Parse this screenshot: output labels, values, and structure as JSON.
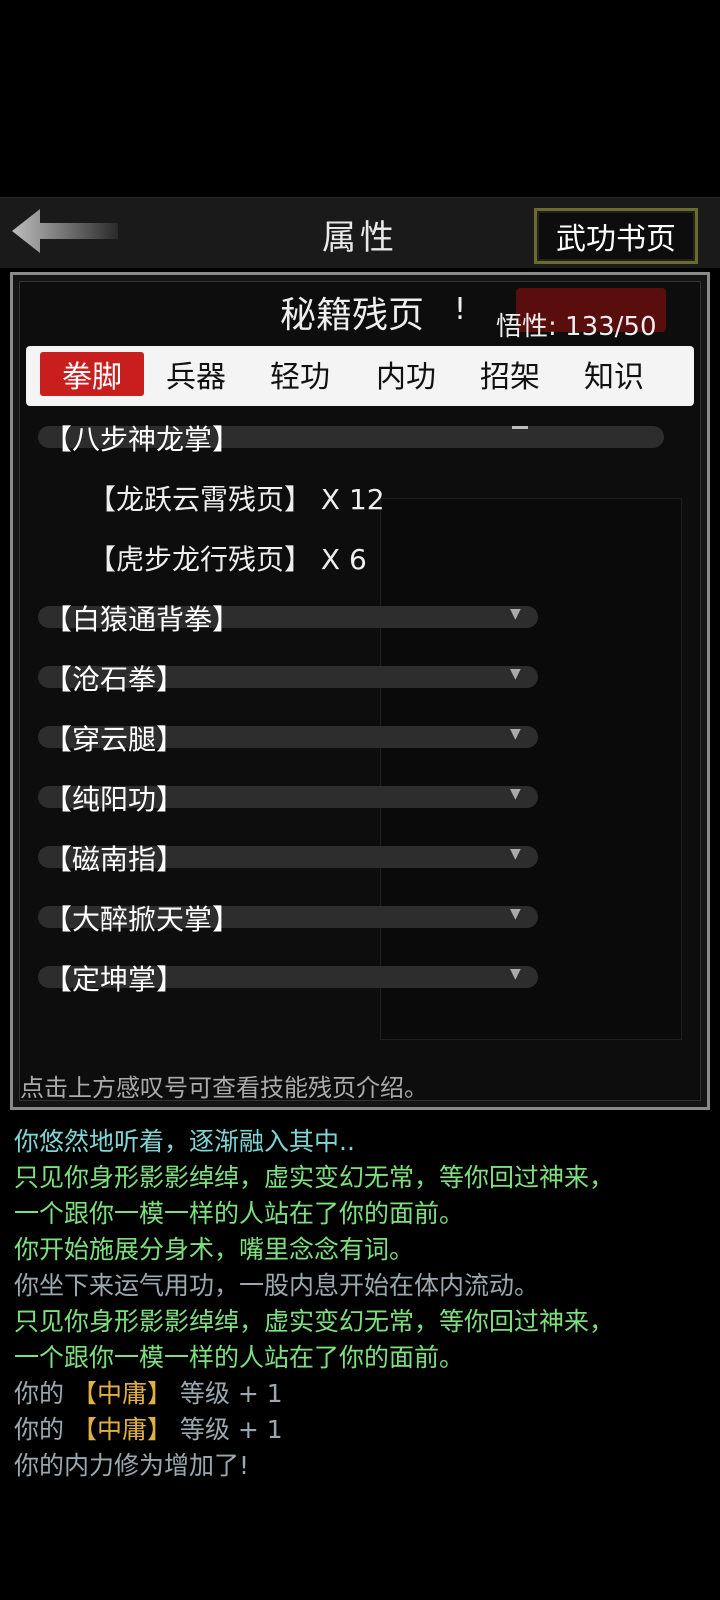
{
  "header": {
    "title": "属性",
    "right_button": "武功书页"
  },
  "panel": {
    "title": "秘籍残页",
    "exclaim": "!",
    "wuxing": "悟性: 133/50",
    "hint": "点击上方感叹号可查看技能残页介绍。"
  },
  "categories": [
    {
      "label": "拳脚",
      "active": true
    },
    {
      "label": "兵器",
      "active": false
    },
    {
      "label": "轻功",
      "active": false
    },
    {
      "label": "内功",
      "active": false
    },
    {
      "label": "招架",
      "active": false
    },
    {
      "label": "知识",
      "active": false
    }
  ],
  "groups": [
    {
      "label": "【八步神龙掌】",
      "open": true,
      "items": [
        {
          "label": "【龙跃云霄残页】 X 12"
        },
        {
          "label": "【虎步龙行残页】 X 6"
        }
      ]
    },
    {
      "label": "【白猿通背拳】",
      "open": false
    },
    {
      "label": "【沧石拳】",
      "open": false
    },
    {
      "label": "【穿云腿】",
      "open": false
    },
    {
      "label": "【纯阳功】",
      "open": false
    },
    {
      "label": "【磁南指】",
      "open": false
    },
    {
      "label": "【大醉掀天掌】",
      "open": false
    },
    {
      "label": "【定坤掌】",
      "open": false
    }
  ],
  "log": [
    {
      "text": "你悠然地听着，逐渐融入其中..",
      "color": "#7fd4d4"
    },
    {
      "text": "只见你身形影影绰绰，虚实变幻无常，等你回过神来，",
      "color": "#7de07d"
    },
    {
      "text": "一个跟你一模一样的人站在了你的面前。",
      "color": "#7de07d"
    },
    {
      "text": "你开始施展分身术，嘴里念念有词。",
      "color": "#7de07d"
    },
    {
      "text": "你坐下来运气用功，一股内息开始在体内流动。",
      "color": "#9aa8b0"
    },
    {
      "text": "只见你身形影影绰绰，虚实变幻无常，等你回过神来，",
      "color": "#7de07d"
    },
    {
      "text": "一个跟你一模一样的人站在了你的面前。",
      "color": "#7de07d"
    },
    {
      "prefix": "你的 ",
      "highlight": "【中庸】",
      "suffix": " 等级 + 1"
    },
    {
      "prefix": "你的 ",
      "highlight": "【中庸】",
      "suffix": " 等级 + 1"
    },
    {
      "text": "你的内力修为增加了!",
      "color": "#9aa8b0"
    }
  ]
}
